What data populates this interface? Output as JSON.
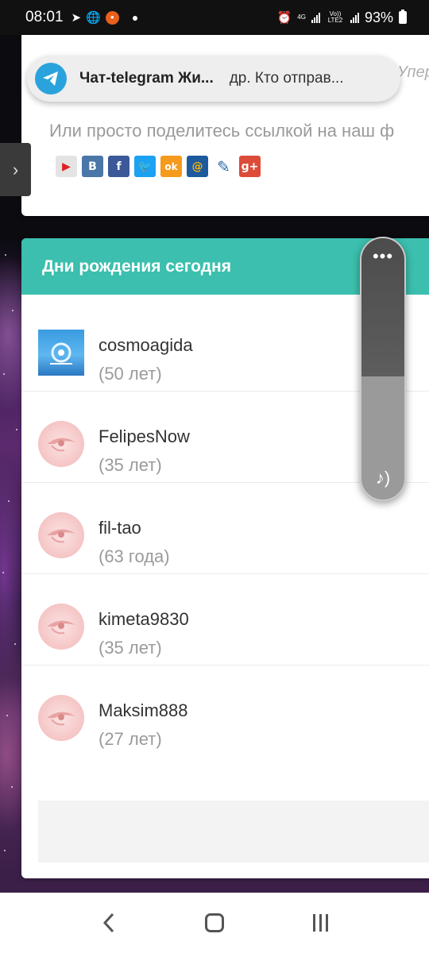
{
  "status_bar": {
    "time": "08:01",
    "network_small_top": "4G",
    "volte_label": "Vo)) LTE2",
    "battery": "93%"
  },
  "notification": {
    "app_icon": "telegram-icon",
    "title": "Чат-telegram Жи...",
    "message": "др. Кто отправ..."
  },
  "share": {
    "partial_italic": "Упер",
    "text": "Или просто поделитесь ссылкой на наш ф",
    "icons": [
      "youtube-icon",
      "vk-icon",
      "facebook-icon",
      "twitter-icon",
      "odnoklassniki-icon",
      "mailru-icon",
      "livejournal-icon",
      "googleplus-icon"
    ],
    "icon_letters": {
      "vk": "В",
      "facebook": "f",
      "odnoklassniki": "ok",
      "mailru": "@",
      "googleplus": "g+"
    }
  },
  "birthdays": {
    "title": "Дни рождения сегодня",
    "users": [
      {
        "name": "cosmoagida",
        "age": "(50 лет)"
      },
      {
        "name": "FelipesNow",
        "age": "(35 лет)"
      },
      {
        "name": "fil-tao",
        "age": "(63 года)"
      },
      {
        "name": "kimeta9830",
        "age": "(35 лет)"
      },
      {
        "name": "Maksim888",
        "age": "(27 лет)"
      }
    ]
  },
  "volume": {
    "more_label": "•••",
    "level": 0.47
  },
  "colors": {
    "header_teal": "#3cbfae",
    "telegram_blue": "#2aa3dd"
  }
}
